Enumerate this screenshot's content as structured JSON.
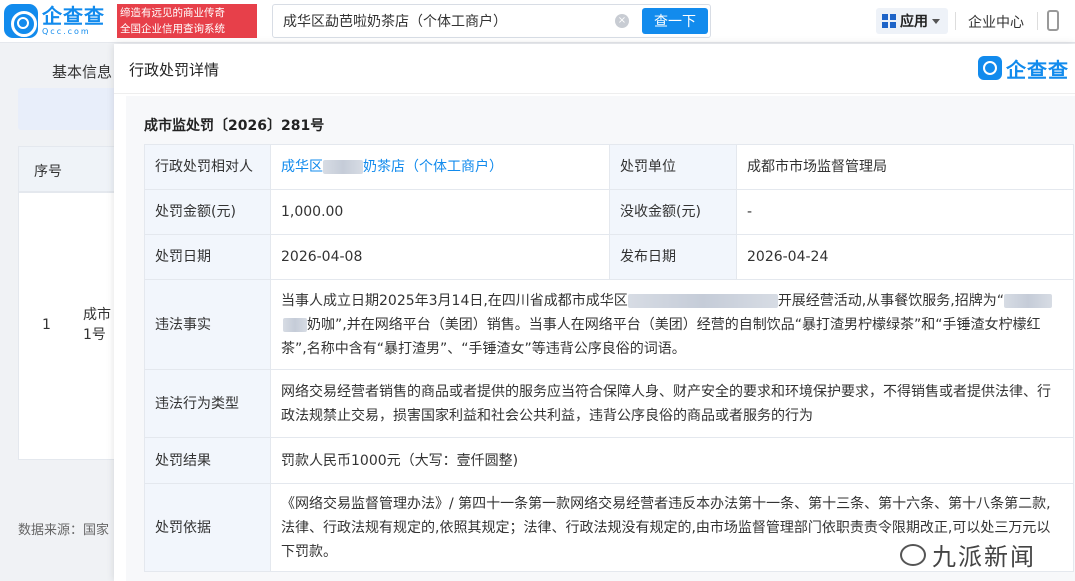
{
  "topbar": {
    "logo_cn": "企查查",
    "logo_en": "Qcc.com",
    "slogan_line1": "缔造有远见的商业传奇",
    "slogan_line2": "全国企业信用查询系统",
    "search_value": "成华区勐芭啦奶茶店（个体工商户）",
    "clear_symbol": "×",
    "search_button": "查一下",
    "apps_label": "应用",
    "enterprise_center": "企业中心"
  },
  "background": {
    "tab_label": "基本信息",
    "table_header": "序号",
    "row_number": "1",
    "row_cell_line1": "成市",
    "row_cell_line2": "1号",
    "data_source": "数据来源：国家"
  },
  "modal": {
    "title": "行政处罚详情",
    "logo_text": "企查查",
    "case_number": "成市监处罚〔2026〕281号",
    "rows": {
      "party_label": "行政处罚相对人",
      "party_prefix": "成华区",
      "party_suffix": "奶茶店（个体工商户）",
      "unit_label": "处罚单位",
      "unit_value": "成都市市场监督管理局",
      "amount_label": "处罚金额(元)",
      "amount_value": "1,000.00",
      "confiscation_label": "没收金额(元)",
      "confiscation_value": "-",
      "date_label": "处罚日期",
      "date_value": "2026-04-08",
      "publish_label": "发布日期",
      "publish_value": "2026-04-24",
      "facts_label": "违法事实",
      "facts_part1": "当事人成立日期2025年3月14日,在四川省成都市成华区",
      "facts_part2": "开展经营活动,从事餐饮服务,招牌为“",
      "facts_part3": "奶咖”,并在网络平台（美团）销售。当事人在网络平台（美团）经营的自制饮品“暴打渣男柠檬绿茶”和“手锤渣女柠檬红茶”,名称中含有“暴打渣男”、“手锤渣女”等违背公序良俗的词语。",
      "type_label": "违法行为类型",
      "type_value": "网络交易经营者销售的商品或者提供的服务应当符合保障人身、财产安全的要求和环境保护要求，不得销售或者提供法律、行政法规禁止交易，损害国家利益和社会公共利益，违背公序良俗的商品或者服务的行为",
      "result_label": "处罚结果",
      "result_value": "罚款人民币1000元（大写：壹仟圆整)",
      "basis_label": "处罚依据",
      "basis_value": "《网络交易监督管理办法》/ 第四十一条第一款网络交易经营者违反本办法第十一条、第十三条、第十六条、第十八条第二款,法律、行政法规有规定的,依照其规定；法律、行政法规没有规定的,由市场监督管理部门依职责责令限期改正,可以处三万元以下罚款。"
    }
  },
  "watermark": {
    "text": "九派新闻"
  }
}
